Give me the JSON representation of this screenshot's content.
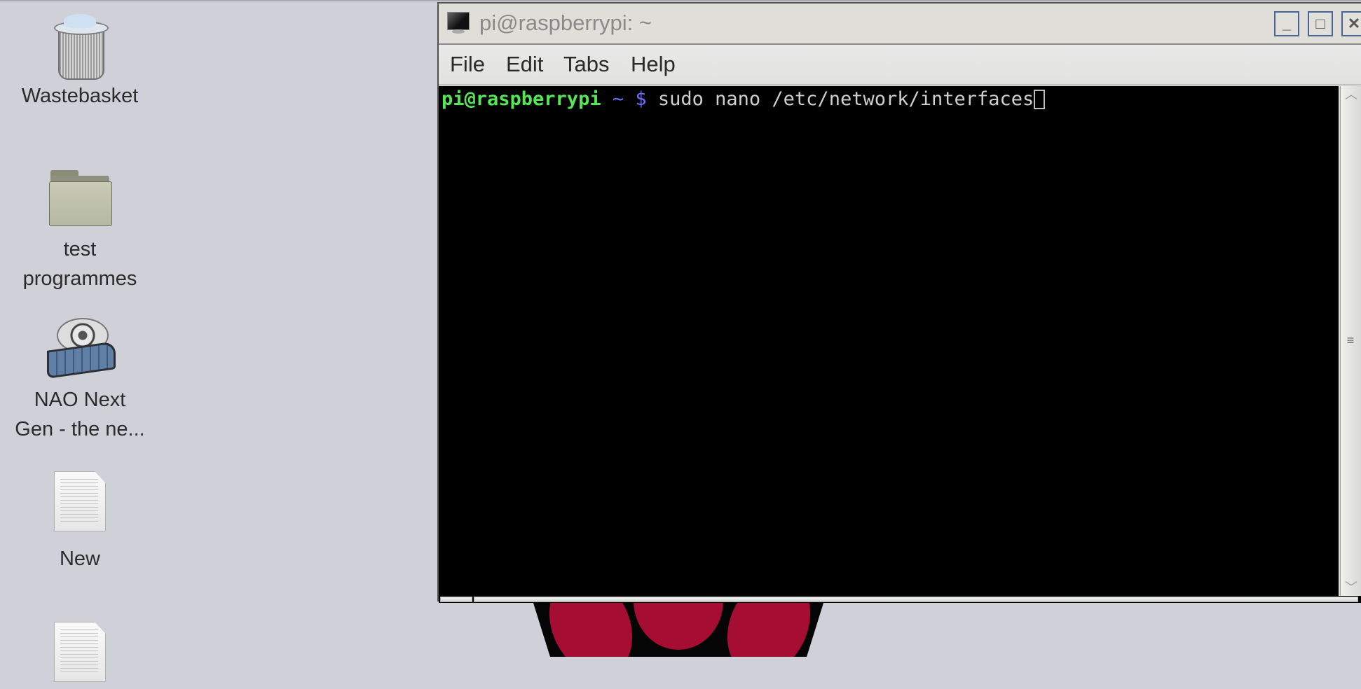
{
  "desktop": {
    "icons": [
      {
        "label_lines": [
          "Wastebasket"
        ],
        "icon": "trash-icon"
      },
      {
        "label_lines": [
          "test",
          "programmes"
        ],
        "icon": "folder-icon"
      },
      {
        "label_lines": [
          "NAO Next",
          "Gen - the ne..."
        ],
        "icon": "video-file-icon"
      },
      {
        "label_lines": [
          "New"
        ],
        "icon": "text-file-icon"
      },
      {
        "label_lines": [
          ""
        ],
        "icon": "text-file-icon"
      }
    ],
    "background_color": "#d0d0d8",
    "logo_color": "#a50d33"
  },
  "window": {
    "title": "pi@raspberrypi: ~",
    "controls": {
      "minimize": "_",
      "maximize": "□",
      "close": "✕"
    },
    "menu": [
      "File",
      "Edit",
      "Tabs",
      "Help"
    ],
    "terminal": {
      "prompt_user": "pi@raspberrypi",
      "prompt_path": " ~ $ ",
      "command": "sudo nano /etc/network/interfaces"
    },
    "scrollbar": {
      "up": "︿",
      "down": "﹀",
      "grip": "≡"
    }
  }
}
